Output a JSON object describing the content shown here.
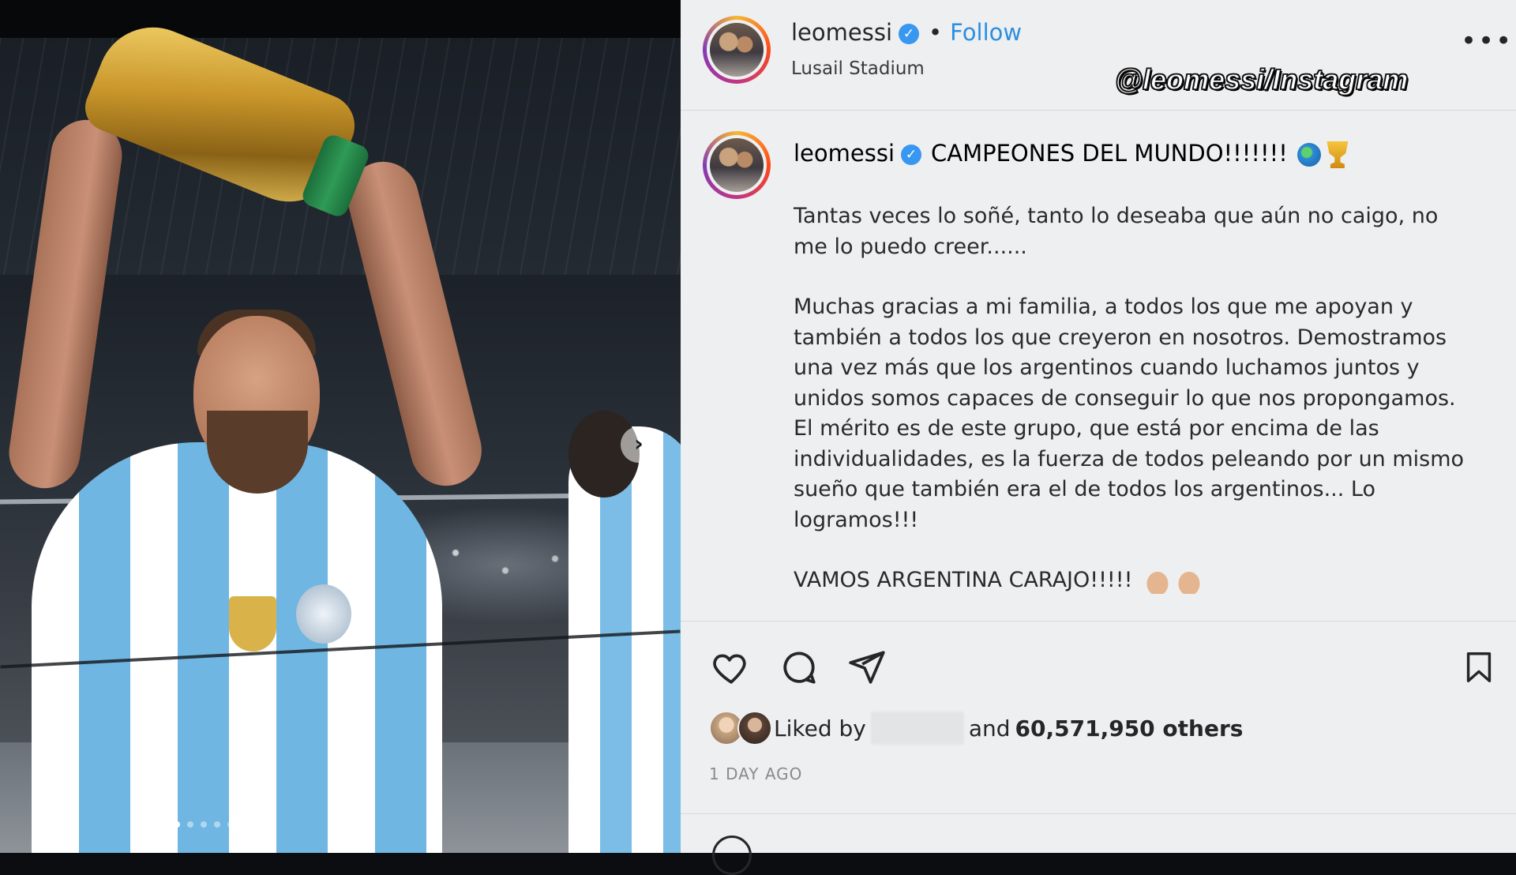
{
  "post": {
    "username": "leomessi",
    "separator": "•",
    "follow_label": "Follow",
    "location": "Lusail Stadium",
    "more_label": "•••"
  },
  "watermark": "@leomessi/Instagram",
  "caption": {
    "username": "leomessi",
    "title": "CAMPEONES DEL MUNDO!!!!!!!",
    "paragraphs": [
      "Tantas veces lo soñé, tanto lo deseaba que aún no caigo, no me lo puedo creer......",
      "Muchas gracias a mi familia, a todos los que me apoyan y también a todos los que creyeron en nosotros. Demostramos una vez más que los argentinos cuando luchamos juntos y unidos somos capaces de conseguir lo que nos propongamos. El mérito es de este grupo, que está por encima de las individualidades, es la fuerza de todos peleando por un mismo sueño que también era el de todos los argentinos... Lo logramos!!!",
      "VAMOS ARGENTINA CARAJO!!!!!"
    ]
  },
  "icons": {
    "verified": "verified-badge",
    "globe": "globe-emoji",
    "trophy": "trophy-emoji",
    "hands": "raising-hands-emoji",
    "like": "heart-icon",
    "comment": "comment-icon",
    "share": "share-icon",
    "save": "bookmark-icon",
    "next": "chevron-right-icon"
  },
  "carousel": {
    "next_glyph": "›",
    "current": 1,
    "total": 6
  },
  "likes": {
    "prefix": "Liked by",
    "middle": "and",
    "count_text": "60,571,950 others"
  },
  "timestamp": "1 DAY AGO",
  "colors": {
    "link_blue": "#2b8fe0",
    "verified_blue": "#3897f0",
    "panel_bg": "#eeeff1",
    "text": "#262626"
  }
}
